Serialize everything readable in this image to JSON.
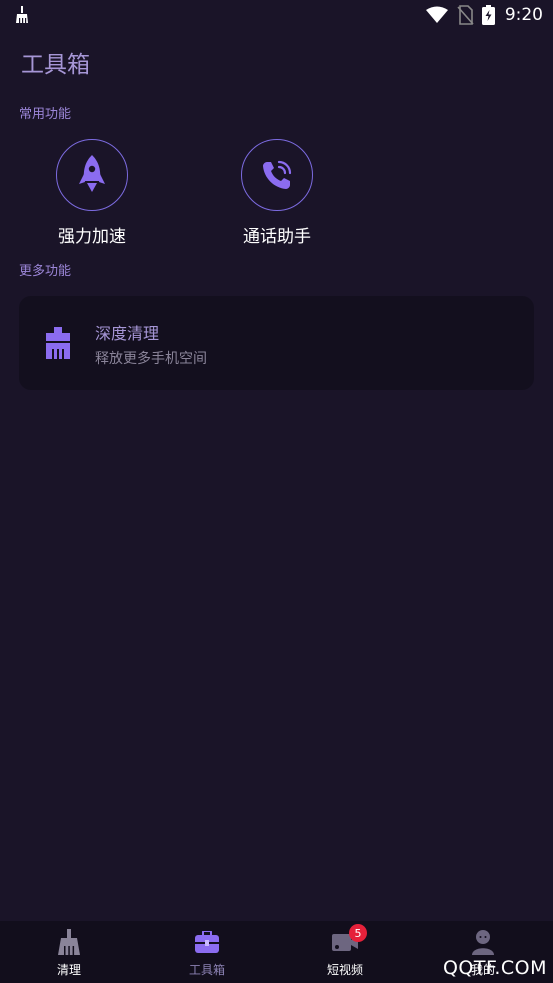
{
  "status_bar": {
    "time": "9:20",
    "left_icon": "cleaner-notification-icon",
    "icons": [
      "wifi-icon",
      "no-sim-icon",
      "battery-charging-icon"
    ]
  },
  "page": {
    "title": "工具箱"
  },
  "sections": {
    "common_label": "常用功能",
    "more_label": "更多功能"
  },
  "common_tools": [
    {
      "label": "强力加速",
      "icon": "rocket-icon"
    },
    {
      "label": "通话助手",
      "icon": "phone-call-icon"
    }
  ],
  "more_tools": [
    {
      "title": "深度清理",
      "subtitle": "释放更多手机空间",
      "icon": "brush-icon"
    }
  ],
  "bottom_nav": {
    "items": [
      {
        "label": "清理",
        "icon": "broom-icon",
        "color": "#ffffff"
      },
      {
        "label": "工具箱",
        "icon": "toolbox-icon",
        "color": "#8c82b4",
        "active": true
      },
      {
        "label": "短视频",
        "icon": "video-icon",
        "color": "#ffffff",
        "badge": "5"
      },
      {
        "label": "我的",
        "icon": "user-icon",
        "color": "#ffffff"
      }
    ]
  },
  "watermark": "QQTF.COM",
  "colors": {
    "background": "#1a1428",
    "accent": "#7c6be0",
    "card": "#130f1e",
    "badge": "#e5213a"
  }
}
